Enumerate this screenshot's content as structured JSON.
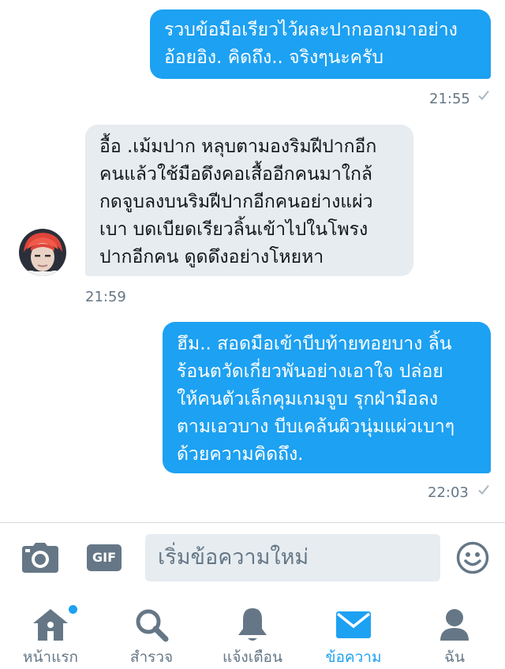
{
  "conversation": {
    "messages": [
      {
        "direction": "outgoing",
        "lines": [
          "รวบข้อมือเรียวไว้ผละปากออกมาอย่าง",
          "อ้อยอิง. คิดถึง.. จริงๆนะครับ"
        ],
        "time": "21:55"
      },
      {
        "direction": "incoming",
        "lines": [
          "อื้อ .เม้มปาก หลุบตามองริมฝีปากอีก",
          "คนแล้วใช้มือดึงคอเสื้ออีกคนมาใกล้",
          "กดจูบลงบนริมฝีปากอีกคนอย่างแผ่ว",
          "เบา บดเบียดเรียวลิ้นเข้าไปในโพรง",
          "ปากอีกคน ดูดดึงอย่างโหยหา"
        ],
        "time": "21:59"
      },
      {
        "direction": "outgoing",
        "lines": [
          "ฮึม.. สอดมือเข้าบีบท้ายทอยบาง ลิ้น",
          "ร้อนตวัดเกี่ยวพันอย่างเอาใจ ปล่อย",
          "ให้คนตัวเล็กคุมเกมจูบ รุกฝ่ามือลง",
          "ตามเอวบาง บีบเคล้นผิวนุ่มแผ่วเบาๆ",
          "ด้วยความคิดถึง."
        ],
        "time": "22:03"
      }
    ],
    "sent_check_icon": "checkmark-icon"
  },
  "composer": {
    "camera_icon": "camera-icon",
    "gif_label": "GIF",
    "placeholder": "เริ่มข้อความใหม่",
    "emoji_icon": "emoji-icon"
  },
  "tabbar": {
    "tabs": [
      {
        "label": "หน้าแรก",
        "icon": "home-icon",
        "active": false,
        "has_dot": true
      },
      {
        "label": "สำรวจ",
        "icon": "search-icon",
        "active": false
      },
      {
        "label": "แจ้งเตือน",
        "icon": "bell-icon",
        "active": false
      },
      {
        "label": "ข้อความ",
        "icon": "mail-icon",
        "active": true
      },
      {
        "label": "ฉัน",
        "icon": "user-icon",
        "active": false
      }
    ]
  },
  "colors": {
    "accent": "#1da1f2",
    "incoming_bubble": "#e6ecf0",
    "muted": "#657786"
  }
}
